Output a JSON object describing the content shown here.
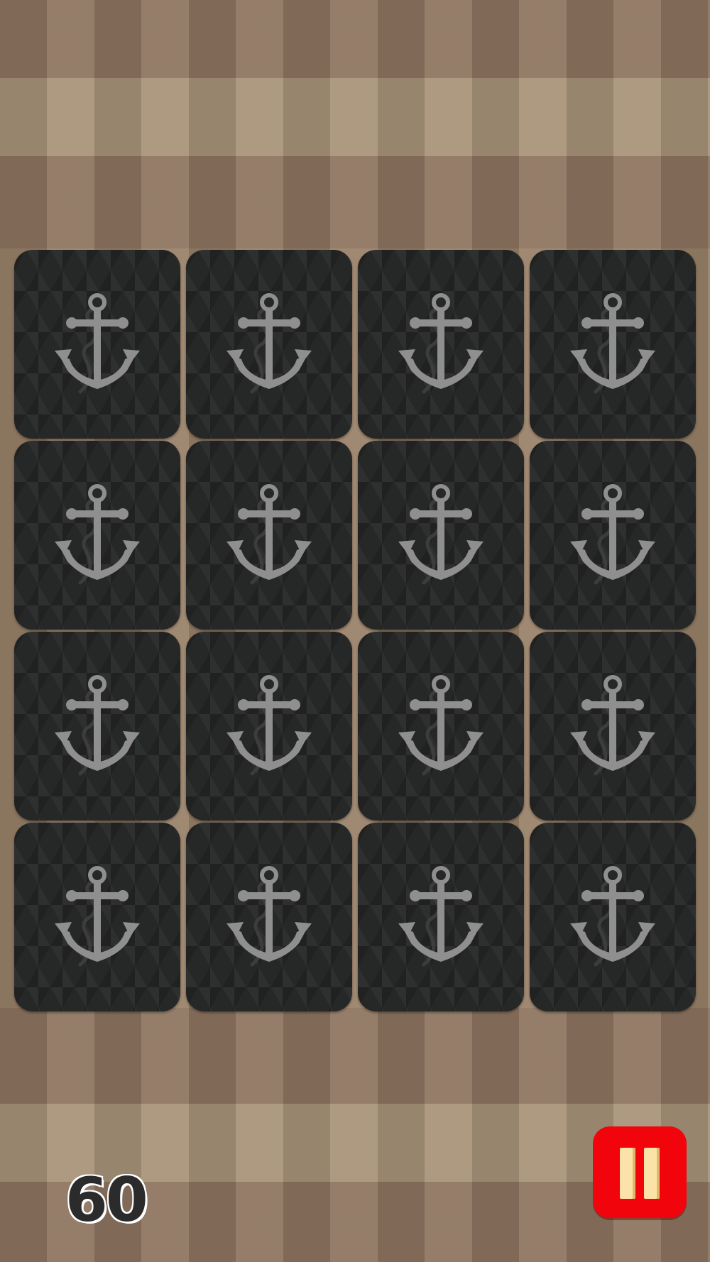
{
  "game": {
    "title": "",
    "grid": {
      "rows": 4,
      "columns": 4
    },
    "card_back_icon": "anchor-icon",
    "colors": {
      "card_back": "#262727",
      "anchor": "#8f8f8f",
      "pause_button": "#f2040c",
      "pause_glyph": "#fbe2a8",
      "timer_text": "#2b2b2b"
    },
    "cards": [
      {
        "id": 1,
        "face": "down"
      },
      {
        "id": 2,
        "face": "down"
      },
      {
        "id": 3,
        "face": "down"
      },
      {
        "id": 4,
        "face": "down"
      },
      {
        "id": 5,
        "face": "down"
      },
      {
        "id": 6,
        "face": "down"
      },
      {
        "id": 7,
        "face": "down"
      },
      {
        "id": 8,
        "face": "down"
      },
      {
        "id": 9,
        "face": "down"
      },
      {
        "id": 10,
        "face": "down"
      },
      {
        "id": 11,
        "face": "down"
      },
      {
        "id": 12,
        "face": "down"
      },
      {
        "id": 13,
        "face": "down"
      },
      {
        "id": 14,
        "face": "down"
      },
      {
        "id": 15,
        "face": "down"
      },
      {
        "id": 16,
        "face": "down"
      }
    ]
  },
  "hud": {
    "timer": "60",
    "pause_icon": "pause-icon"
  }
}
